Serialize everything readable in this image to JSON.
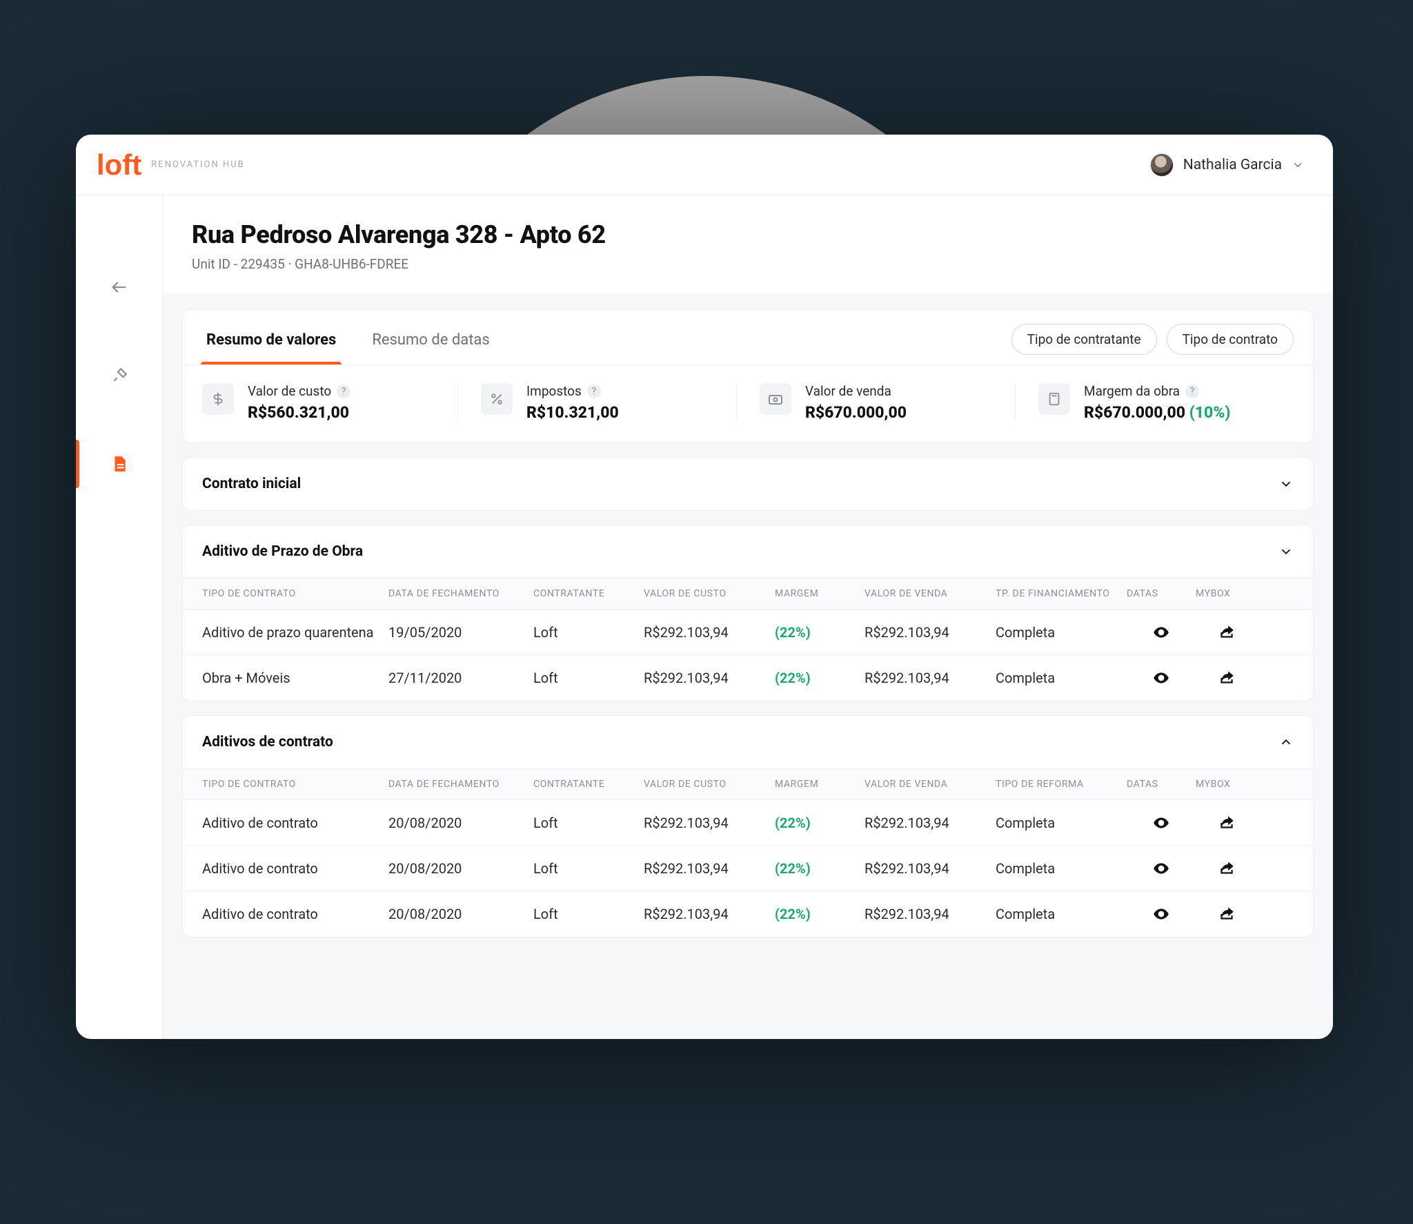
{
  "brand": {
    "logo": "loft",
    "sub": "RENOVATION HUB"
  },
  "user": {
    "name": "Nathalia Garcia"
  },
  "header": {
    "title": "Rua Pedroso Alvarenga 328 - Apto 62",
    "sub": "Unit ID - 229435   ·   GHA8-UHB6-FDREE"
  },
  "tabs": {
    "a": "Resumo de valores",
    "b": "Resumo de datas"
  },
  "pills": {
    "a": "Tipo de contratante",
    "b": "Tipo de contrato"
  },
  "metrics": {
    "cost": {
      "label": "Valor de custo",
      "value": "R$560.321,00"
    },
    "tax": {
      "label": "Impostos",
      "value": "R$10.321,00"
    },
    "sale": {
      "label": "Valor de venda",
      "value": "R$670.000,00"
    },
    "margin": {
      "label": "Margem da obra",
      "value": "R$670.000,00",
      "pct": "(10%)"
    }
  },
  "sections": {
    "initial": {
      "title": "Contrato inicial"
    },
    "deadline": {
      "title": "Aditivo de Prazo de Obra",
      "cols": {
        "c1": "TIPO DE CONTRATO",
        "c2": "DATA DE FECHAMENTO",
        "c3": "CONTRATANTE",
        "c4": "VALOR DE CUSTO",
        "c5": "MARGEM",
        "c6": "VALOR DE VENDA",
        "c7": "TP. DE FINANCIAMENTO",
        "c8": "DATAS",
        "c9": "MYBOX"
      },
      "rows": [
        {
          "type": "Aditivo de prazo quarentena",
          "date": "19/05/2020",
          "party": "Loft",
          "cost": "R$292.103,94",
          "margin": "(22%)",
          "sale": "R$292.103,94",
          "fin": "Completa"
        },
        {
          "type": "Obra + Móveis",
          "date": "27/11/2020",
          "party": "Loft",
          "cost": "R$292.103,94",
          "margin": "(22%)",
          "sale": "R$292.103,94",
          "fin": "Completa"
        }
      ]
    },
    "amend": {
      "title": "Aditivos de contrato",
      "cols": {
        "c1": "TIPO DE CONTRATO",
        "c2": "DATA DE FECHAMENTO",
        "c3": "CONTRATANTE",
        "c4": "VALOR DE CUSTO",
        "c5": "MARGEM",
        "c6": "VALOR DE VENDA",
        "c7": "TIPO DE REFORMA",
        "c8": "DATAS",
        "c9": "MYBOX"
      },
      "rows": [
        {
          "type": "Aditivo de contrato",
          "date": "20/08/2020",
          "party": "Loft",
          "cost": "R$292.103,94",
          "margin": "(22%)",
          "sale": "R$292.103,94",
          "fin": "Completa"
        },
        {
          "type": "Aditivo de contrato",
          "date": "20/08/2020",
          "party": "Loft",
          "cost": "R$292.103,94",
          "margin": "(22%)",
          "sale": "R$292.103,94",
          "fin": "Completa"
        },
        {
          "type": "Aditivo de contrato",
          "date": "20/08/2020",
          "party": "Loft",
          "cost": "R$292.103,94",
          "margin": "(22%)",
          "sale": "R$292.103,94",
          "fin": "Completa"
        }
      ]
    }
  }
}
